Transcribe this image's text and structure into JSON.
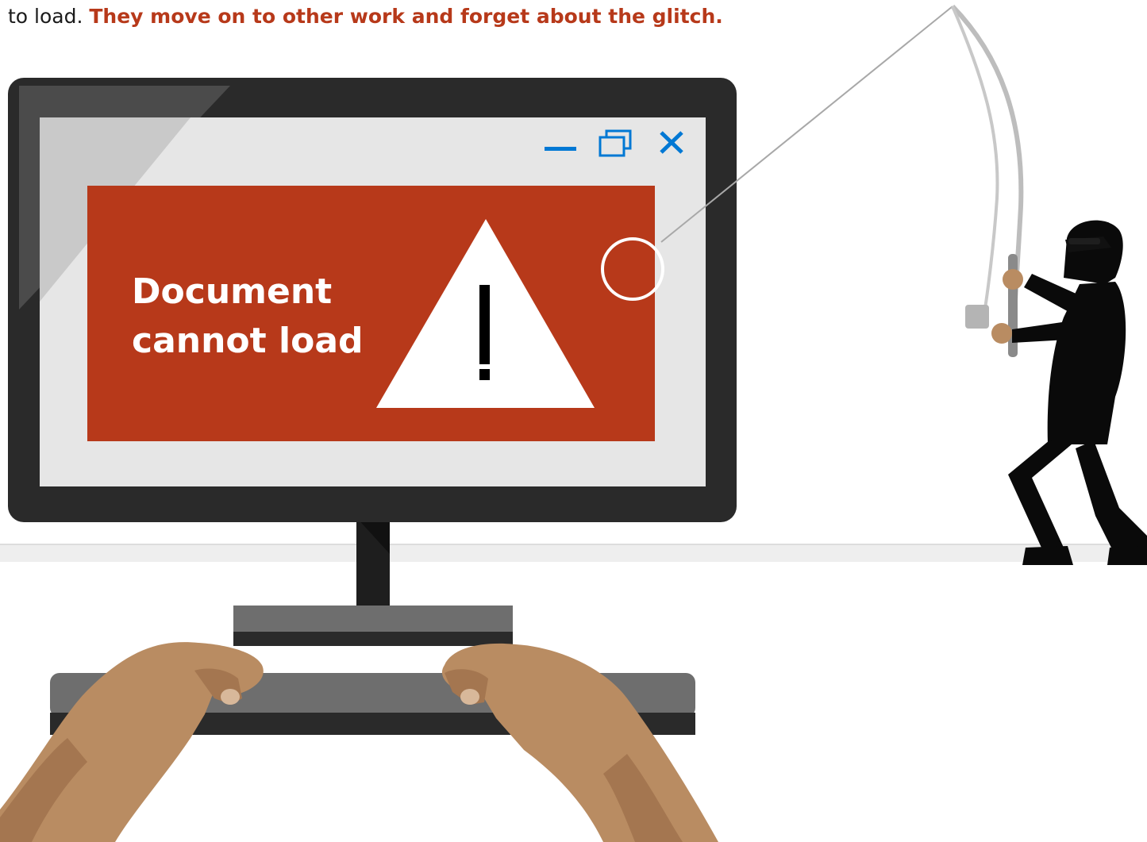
{
  "caption": {
    "lead": "to load. ",
    "highlight": "They move on to other work and forget about the glitch."
  },
  "dialog": {
    "title_line1": "Document",
    "title_line2": "cannot load",
    "warning_mark": "!"
  },
  "window_controls": {
    "minimize_icon": "minimize-icon",
    "restore_icon": "restore-icon",
    "close_icon": "close-icon"
  },
  "colors": {
    "accent_red": "#b7391a",
    "window_bg": "#e6e6e6",
    "control_blue": "#0078d4",
    "monitor_frame": "#2a2a2a",
    "skin": "#b98c62",
    "hacker": "#0a0a0a"
  }
}
